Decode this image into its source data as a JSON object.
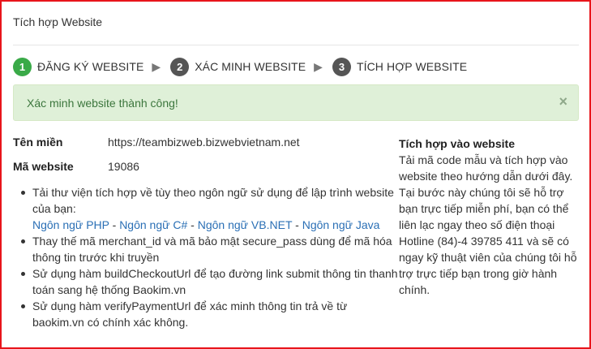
{
  "panel": {
    "title": "Tích hợp Website"
  },
  "steps": [
    {
      "number": "1",
      "label": "ĐĂNG KÝ WEBSITE",
      "status": "done"
    },
    {
      "number": "2",
      "label": "XÁC MINH WEBSITE",
      "status": "pending"
    },
    {
      "number": "3",
      "label": "TÍCH HỢP WEBSITE",
      "status": "pending"
    }
  ],
  "step_separator": "▶",
  "alert": {
    "message": "Xác minh website thành công!",
    "close_glyph": "×",
    "color": "#3c763d",
    "background": "#dff0d8"
  },
  "fields": {
    "domain": {
      "label": "Tên miền",
      "value": "https://teambizweb.bizwebvietnam.net"
    },
    "website_code": {
      "label": "Mã website",
      "value": "19086"
    }
  },
  "instructions": {
    "item1_text": "Tải thư viện tích hợp về tùy theo ngôn ngữ sử dụng để lập trình website của bạn:",
    "languages": [
      "Ngôn ngữ PHP",
      "Ngôn ngữ C#",
      "Ngôn ngữ VB.NET",
      "Ngôn ngữ Java"
    ],
    "separator": " - ",
    "item2_text": "Thay thế mã merchant_id và mã bảo mật secure_pass dùng để mã hóa thông tin trước khi truyền",
    "item3_text": "Sử dụng hàm buildCheckoutUrl để tạo đường link submit thông tin thanh toán sang hệ thống Baokim.vn",
    "item4_text": "Sử dụng hàm verifyPaymentUrl để xác minh thông tin trả về từ baokim.vn có chính xác không."
  },
  "side": {
    "title": "Tích hợp vào website",
    "body": "Tải mã code mẫu và tích hợp vào website theo hướng dẫn dưới đây. Tại bước này chúng tôi sẽ hỗ trợ bạn trực tiếp miễn phí, bạn có thể liên lạc ngay theo số điện thoại Hotline (84)-4 39785 411 và sẽ có ngay kỹ thuật viên của chúng tôi hỗ trợ trực tiếp bạn trong giờ hành chính."
  },
  "colors": {
    "frame_border": "#e8151b",
    "step_active": "#3aaa48",
    "step_inactive": "#555555",
    "link": "#2a6fb5"
  }
}
